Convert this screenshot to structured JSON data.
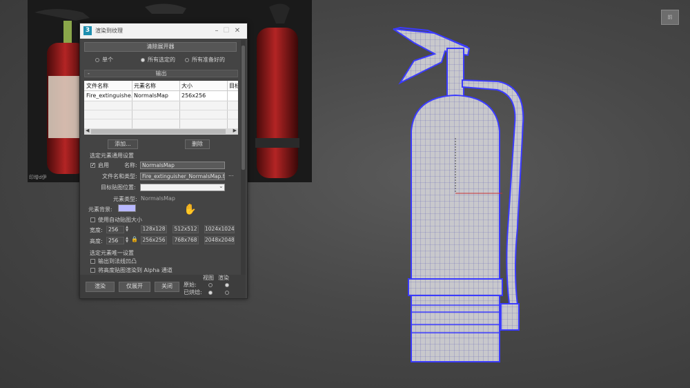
{
  "reference_photo": {
    "caption": "印增d伊"
  },
  "viewport": {
    "cube_label": "前"
  },
  "dialog": {
    "title": "渲染到纹理",
    "clear_unwrapper_button": "清除展开器",
    "radio_single": "单个",
    "radio_all_selected": "所有选定的",
    "radio_all_prepared": "所有准备好的",
    "output_section_title": "输出",
    "table": {
      "columns": [
        "文件名称",
        "元素名称",
        "大小",
        "目标"
      ],
      "rows": [
        [
          "Fire_extinguishe...",
          "NormalsMap",
          "256x256",
          ""
        ]
      ]
    },
    "add_button": "添加...",
    "delete_button": "删除",
    "common_settings_title": "选定元素通用设置",
    "enable_label": "启用",
    "enable_checked": true,
    "name_label": "名称:",
    "name_value": "NormalsMap",
    "file_name_type_label": "文件名和类型:",
    "file_name_value": "Fire_extinguisher_NormalsMap.tga",
    "browse_label": "...",
    "target_map_slot_label": "目标贴图位置:",
    "target_map_slot_value": "",
    "element_type_label": "元素类型:",
    "element_type_value": "NormalsMap",
    "element_bg_label": "元素背景:",
    "element_bg_color": "#b8b8ff",
    "auto_map_size_label": "使用自动贴图大小",
    "width_label": "宽度:",
    "width_value": "256",
    "height_label": "高度:",
    "height_value": "256",
    "size_presets_row1": [
      "128x128",
      "512x512",
      "1024x1024"
    ],
    "size_presets_row2": [
      "256x256",
      "768x768",
      "2048x2048"
    ],
    "unique_settings_title": "选定元素唯一设置",
    "output_to_normal_bump_label": "输出到法线凹凸",
    "render_height_alpha_label": "将高度贴图渲染到 Alpha 通道",
    "render_button": "渲染",
    "unwrap_only_button": "仅展开",
    "close_button": "关闭",
    "original_label": "原始:",
    "baked_label": "已烘焙:",
    "view_label": "视图",
    "render_label": "渲染"
  },
  "colors": {
    "wireframe": "#3b3bff",
    "mesh_fill": "#c9c9ce",
    "extinguisher_red": "#9a1c1c"
  }
}
